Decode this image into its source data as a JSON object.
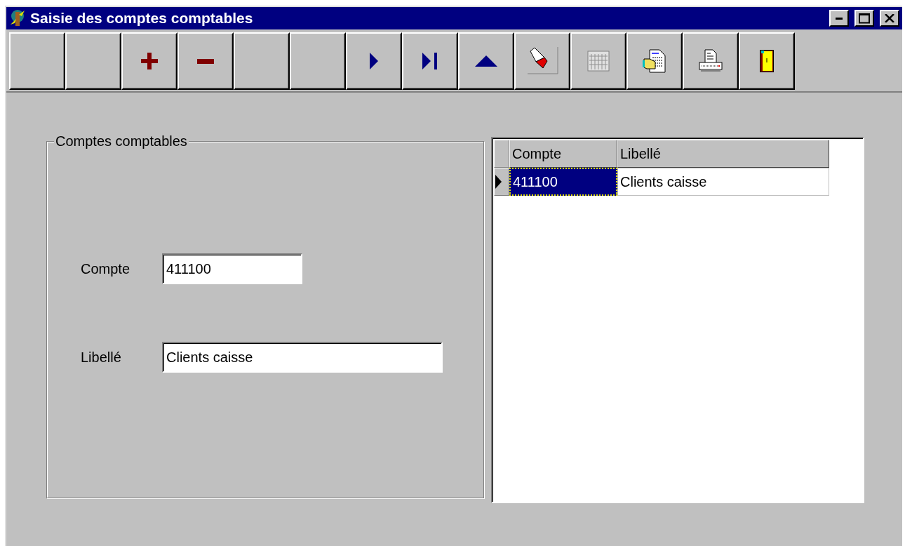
{
  "window": {
    "title": "Saisie des comptes comptables"
  },
  "toolbar": [
    {
      "kind": "blank"
    },
    {
      "kind": "blank"
    },
    {
      "kind": "add"
    },
    {
      "kind": "remove"
    },
    {
      "kind": "blank"
    },
    {
      "kind": "blank"
    },
    {
      "kind": "next"
    },
    {
      "kind": "last"
    },
    {
      "kind": "up"
    },
    {
      "kind": "flashlight"
    },
    {
      "kind": "calendar"
    },
    {
      "kind": "document"
    },
    {
      "kind": "printer"
    },
    {
      "kind": "exit"
    }
  ],
  "group": {
    "title": "Comptes comptables",
    "fields": [
      {
        "label": "Compte",
        "value": "411100",
        "kind": "short"
      },
      {
        "label": "Libellé",
        "value": "Clients caisse",
        "kind": "long"
      }
    ]
  },
  "grid": {
    "columns": [
      "Compte",
      "Libellé"
    ],
    "rows": [
      {
        "selected": true,
        "cells": [
          {
            "text": "411100",
            "selected": true
          },
          {
            "text": "Clients caisse",
            "selected": false
          }
        ]
      }
    ]
  }
}
